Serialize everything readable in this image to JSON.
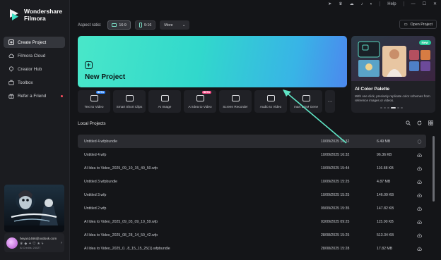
{
  "app": {
    "brand_line1": "Wondershare",
    "brand_line2": "Filmora",
    "help_label": "Help",
    "accent": "#3fe0c5"
  },
  "sidebar": {
    "items": [
      {
        "label": "Create Project",
        "icon": "create-project-icon",
        "active": true
      },
      {
        "label": "Filmora Cloud",
        "icon": "cloud-icon"
      },
      {
        "label": "Creator Hub",
        "icon": "creator-hub-icon"
      },
      {
        "label": "Toolbox",
        "icon": "toolbox-icon"
      },
      {
        "label": "Refer a Friend",
        "icon": "gift-icon",
        "badge_dot": true
      }
    ],
    "account": {
      "email": "heyan1466@outlook.com",
      "credits": "AI Credits: 24027"
    }
  },
  "aspect": {
    "label": "Aspect ratio:",
    "option_169": "16:9",
    "option_916": "9:16",
    "more_label": "More"
  },
  "open_project_label": "Open Project",
  "new_project_label": "New Project",
  "feature": {
    "badge": "New",
    "title": "AI Color Palette",
    "description": "With one click, precisely replicate color schemes from reference images or videos."
  },
  "tools": [
    {
      "label": "Text to Video",
      "tag": "BETA"
    },
    {
      "label": "Smart Short Clips",
      "tag": ""
    },
    {
      "label": "AI Image",
      "tag": ""
    },
    {
      "label": "AI Idea to Video",
      "tag": "BETA"
    },
    {
      "label": "Screen Recorder",
      "tag": ""
    },
    {
      "label": "Audio to Video",
      "tag": ""
    },
    {
      "label": "mart BGM Gene",
      "tag": ""
    },
    {
      "label": "···",
      "tag": ""
    }
  ],
  "local_projects": {
    "header": "Local Projects",
    "rows": [
      {
        "name": "Untitled 4.wfpbundle",
        "date": "10/09/2025 16:32",
        "size": "6.49 MB",
        "highlight": true
      },
      {
        "name": "Untitled 4.wfp",
        "date": "10/09/2025 16:32",
        "size": "96.36 KB"
      },
      {
        "name": "AI Idea to Video_2025_09_10_15_40_50.wfp",
        "date": "10/09/2025 15:44",
        "size": "116.88 KB"
      },
      {
        "name": "Untitled 3.wfpbundle",
        "date": "10/09/2025 15:25",
        "size": "4.87 MB"
      },
      {
        "name": "Untitled 3.wfp",
        "date": "10/09/2025 15:25",
        "size": "146.09 KB"
      },
      {
        "name": "Untitled 2.wfp",
        "date": "09/09/2025 15:35",
        "size": "147.82 KB"
      },
      {
        "name": "AI Idea to Video_2025_09_03_09_19_59.wfp",
        "date": "03/09/2025 09:25",
        "size": "115.00 KB"
      },
      {
        "name": "AI Idea to Video_2025_08_28_14_50_42.wfp",
        "date": "28/08/2025 15:25",
        "size": "513.34 KB"
      },
      {
        "name": "AI Idea to Video_2025_0...8_15_15_25(1).wfpbundle",
        "date": "28/08/2025 15:28",
        "size": "17.82 MB"
      }
    ]
  }
}
